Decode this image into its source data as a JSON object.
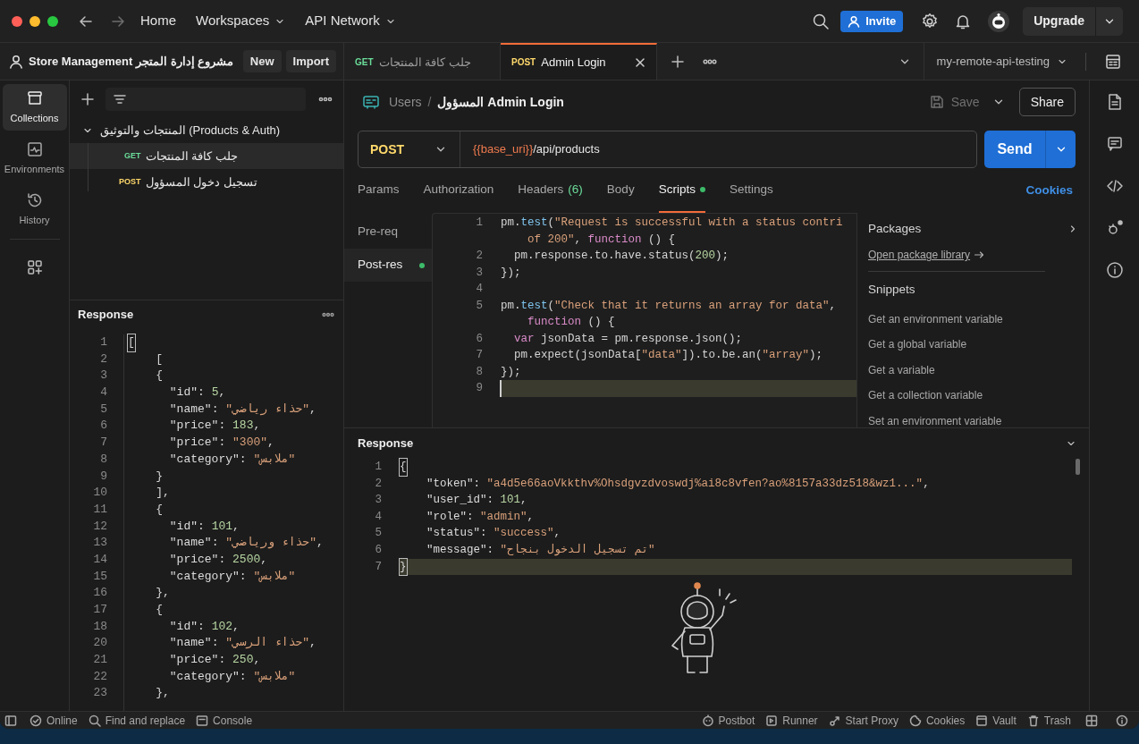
{
  "nav": [
    {
      "label": "Home",
      "dropdown": false
    },
    {
      "label": "Workspaces",
      "dropdown": true
    },
    {
      "label": "API Network",
      "dropdown": true
    }
  ],
  "header": {
    "invite": "Invite",
    "upgrade": "Upgrade"
  },
  "workspace": {
    "name": "Store Management مشروع إدارة المتجر",
    "buttons": [
      "New",
      "Import"
    ]
  },
  "rail": [
    {
      "label": "Collections",
      "selected": true
    },
    {
      "label": "Environments",
      "selected": false
    },
    {
      "label": "History",
      "selected": false
    }
  ],
  "tree": [
    {
      "label": "المنتجات والتوثيق (Products & Auth)",
      "expanded": true,
      "children": [
        {
          "method": "GET",
          "label": "جلب كافة المنتجات",
          "selected": true
        },
        {
          "method": "POST",
          "label": "تسجيل دخول المسؤول",
          "selected": false
        }
      ]
    }
  ],
  "sidebar_response": {
    "title": "Response",
    "lines": [
      {
        "number": "1",
        "segments": [
          {
            "kind": "punct",
            "text": "["
          }
        ]
      },
      {
        "number": "2",
        "segments": [
          {
            "kind": "punct",
            "text": "    ["
          }
        ]
      },
      {
        "number": "3",
        "segments": [
          {
            "kind": "punct",
            "text": "    {"
          }
        ]
      },
      {
        "number": "4",
        "segments": [
          {
            "kind": "key",
            "text": "      \"id\""
          },
          {
            "kind": "punct",
            "text": ": "
          },
          {
            "kind": "number",
            "text": "5"
          },
          {
            "kind": "punct",
            "text": ","
          }
        ]
      },
      {
        "number": "5",
        "segments": [
          {
            "kind": "key",
            "text": "      \"name\""
          },
          {
            "kind": "punct",
            "text": ": "
          },
          {
            "kind": "string",
            "text": "\"حذاء رياضي\""
          },
          {
            "kind": "punct",
            "text": ","
          }
        ]
      },
      {
        "number": "6",
        "segments": [
          {
            "kind": "key",
            "text": "      \"price\""
          },
          {
            "kind": "punct",
            "text": ": "
          },
          {
            "kind": "number",
            "text": "183"
          },
          {
            "kind": "punct",
            "text": ","
          }
        ]
      },
      {
        "number": "7",
        "segments": [
          {
            "kind": "key",
            "text": "      \"price\""
          },
          {
            "kind": "punct",
            "text": ": "
          },
          {
            "kind": "string",
            "text": "\"300\""
          },
          {
            "kind": "punct",
            "text": ","
          }
        ]
      },
      {
        "number": "8",
        "segments": [
          {
            "kind": "key",
            "text": "      \"category\""
          },
          {
            "kind": "punct",
            "text": ": "
          },
          {
            "kind": "string",
            "text": "\"ملابس\""
          }
        ]
      },
      {
        "number": "9",
        "segments": [
          {
            "kind": "punct",
            "text": "    }"
          }
        ]
      },
      {
        "number": "10",
        "segments": [
          {
            "kind": "punct",
            "text": "    ],"
          }
        ]
      },
      {
        "number": "11",
        "segments": [
          {
            "kind": "punct",
            "text": "    {"
          }
        ]
      },
      {
        "number": "12",
        "segments": [
          {
            "kind": "key",
            "text": "      \"id\""
          },
          {
            "kind": "punct",
            "text": ": "
          },
          {
            "kind": "number",
            "text": "101"
          },
          {
            "kind": "punct",
            "text": ","
          }
        ]
      },
      {
        "number": "13",
        "segments": [
          {
            "kind": "key",
            "text": "      \"name\""
          },
          {
            "kind": "punct",
            "text": ": "
          },
          {
            "kind": "string",
            "text": "\"حذاء ورياضي\""
          },
          {
            "kind": "punct",
            "text": ","
          }
        ]
      },
      {
        "number": "14",
        "segments": [
          {
            "kind": "key",
            "text": "      \"price\""
          },
          {
            "kind": "punct",
            "text": ": "
          },
          {
            "kind": "number",
            "text": "2500"
          },
          {
            "kind": "punct",
            "text": ","
          }
        ]
      },
      {
        "number": "15",
        "segments": [
          {
            "kind": "key",
            "text": "      \"category\""
          },
          {
            "kind": "punct",
            "text": ": "
          },
          {
            "kind": "string",
            "text": "\"ملابس\""
          }
        ]
      },
      {
        "number": "16",
        "segments": [
          {
            "kind": "punct",
            "text": "    },"
          }
        ]
      },
      {
        "number": "17",
        "segments": [
          {
            "kind": "punct",
            "text": "    {"
          }
        ]
      },
      {
        "number": "18",
        "segments": [
          {
            "kind": "key",
            "text": "      \"id\""
          },
          {
            "kind": "punct",
            "text": ": "
          },
          {
            "kind": "number",
            "text": "102"
          },
          {
            "kind": "punct",
            "text": ","
          }
        ]
      },
      {
        "number": "20",
        "segments": [
          {
            "kind": "key",
            "text": "      \"name\""
          },
          {
            "kind": "punct",
            "text": ": "
          },
          {
            "kind": "string",
            "text": "\"حذاء الرسي\""
          },
          {
            "kind": "punct",
            "text": ","
          }
        ]
      },
      {
        "number": "21",
        "segments": [
          {
            "kind": "key",
            "text": "      \"price\""
          },
          {
            "kind": "punct",
            "text": ": "
          },
          {
            "kind": "number",
            "text": "250"
          },
          {
            "kind": "punct",
            "text": ","
          }
        ]
      },
      {
        "number": "22",
        "segments": [
          {
            "kind": "key",
            "text": "      \"category\""
          },
          {
            "kind": "punct",
            "text": ": "
          },
          {
            "kind": "string",
            "text": "\"ملابس\""
          }
        ]
      },
      {
        "number": "23",
        "segments": [
          {
            "kind": "punct",
            "text": "    },"
          }
        ]
      }
    ]
  },
  "tabs": [
    {
      "method": "GET",
      "label": "جلب كافة المنتجات",
      "selected": false
    },
    {
      "method": "POST",
      "label": "Admin Login",
      "selected": true
    }
  ],
  "environment": "my-remote-api-testing",
  "breadcrumb": {
    "parent": "Users",
    "separator": "/",
    "current": "المسؤول Admin Login"
  },
  "save": "Save",
  "share": "Share",
  "request": {
    "method": "POST",
    "url_variable": "{{base_uri}}",
    "url_path": "/api/products",
    "send": "Send"
  },
  "request_tabs": [
    {
      "label": "Params",
      "selected": false,
      "indicator": false
    },
    {
      "label": "Authorization",
      "selected": false,
      "indicator": false
    },
    {
      "label": "Headers",
      "count": "(6)",
      "selected": false,
      "indicator": false
    },
    {
      "label": "Body",
      "selected": false,
      "indicator": false
    },
    {
      "label": "Scripts",
      "selected": true,
      "indicator": true
    },
    {
      "label": "Settings",
      "selected": false,
      "indicator": false
    }
  ],
  "cookies_link": "Cookies",
  "script_phases": [
    {
      "label": "Pre-req",
      "selected": false,
      "indicator": false
    },
    {
      "label": "Post-res",
      "selected": true,
      "indicator": true
    }
  ],
  "script_lines": [
    {
      "number": "1",
      "current": false,
      "segments": [
        {
          "kind": "punct",
          "text": "pm."
        },
        {
          "kind": "function",
          "text": "test"
        },
        {
          "kind": "punct",
          "text": "("
        },
        {
          "kind": "string",
          "text": "\"Request is successful with a status contri"
        }
      ]
    },
    {
      "current": false,
      "segments": [
        {
          "kind": "string",
          "text": "    of 200\""
        },
        {
          "kind": "punct",
          "text": ", "
        },
        {
          "kind": "keyword",
          "text": "function"
        },
        {
          "kind": "punct",
          "text": " () {"
        }
      ]
    },
    {
      "number": "2",
      "current": false,
      "segments": [
        {
          "kind": "punct",
          "text": "  pm.response.to.have.status("
        },
        {
          "kind": "number",
          "text": "200"
        },
        {
          "kind": "punct",
          "text": ");"
        }
      ]
    },
    {
      "number": "3",
      "current": false,
      "segments": [
        {
          "kind": "punct",
          "text": "});"
        }
      ]
    },
    {
      "number": "4",
      "current": false
    },
    {
      "number": "5",
      "current": false,
      "segments": [
        {
          "kind": "punct",
          "text": "pm."
        },
        {
          "kind": "function",
          "text": "test"
        },
        {
          "kind": "punct",
          "text": "("
        },
        {
          "kind": "string",
          "text": "\"Check that it returns an array for data\""
        },
        {
          "kind": "punct",
          "text": ","
        }
      ]
    },
    {
      "current": false,
      "segments": [
        {
          "kind": "keyword",
          "text": "    function"
        },
        {
          "kind": "punct",
          "text": " () {"
        }
      ]
    },
    {
      "number": "6",
      "current": false,
      "segments": [
        {
          "kind": "keyword",
          "text": "  var"
        },
        {
          "kind": "punct",
          "text": " jsonData = pm.response.json();"
        }
      ]
    },
    {
      "number": "7",
      "current": false,
      "segments": [
        {
          "kind": "punct",
          "text": "  pm.expect(jsonData["
        },
        {
          "kind": "string",
          "text": "\"data\""
        },
        {
          "kind": "punct",
          "text": "]).to.be.an("
        },
        {
          "kind": "string",
          "text": "\"array\""
        },
        {
          "kind": "punct",
          "text": ");"
        }
      ]
    },
    {
      "number": "8",
      "current": false,
      "segments": [
        {
          "kind": "punct",
          "text": "});"
        }
      ]
    },
    {
      "number": "9",
      "current": true
    }
  ],
  "packages": {
    "title": "Packages",
    "link": "Open package library"
  },
  "snippets": {
    "title": "Snippets",
    "items": [
      "Get an environment variable",
      "Get a global variable",
      "Get a variable",
      "Get a collection variable",
      "Set an environment variable"
    ]
  },
  "response": {
    "title": "Response",
    "lines": [
      {
        "number": "1",
        "current": false,
        "segments": [
          {
            "kind": "punct",
            "text": "{"
          }
        ]
      },
      {
        "number": "2",
        "current": false,
        "segments": [
          {
            "kind": "key",
            "text": "    \"token\""
          },
          {
            "kind": "punct",
            "text": ": "
          },
          {
            "kind": "string",
            "text": "\"a4d5e66aoVkkthv%Ohsdgvzdvoswdj%ai8c8vfen?ao%8157a33dz518&wz1...\""
          },
          {
            "kind": "punct",
            "text": ","
          }
        ]
      },
      {
        "number": "3",
        "current": false,
        "segments": [
          {
            "kind": "key",
            "text": "    \"user_id\""
          },
          {
            "kind": "punct",
            "text": ": "
          },
          {
            "kind": "number",
            "text": "101"
          },
          {
            "kind": "punct",
            "text": ","
          }
        ]
      },
      {
        "number": "4",
        "current": false,
        "segments": [
          {
            "kind": "key",
            "text": "    \"role\""
          },
          {
            "kind": "punct",
            "text": ": "
          },
          {
            "kind": "string",
            "text": "\"admin\""
          },
          {
            "kind": "punct",
            "text": ","
          }
        ]
      },
      {
        "number": "5",
        "current": false,
        "segments": [
          {
            "kind": "key",
            "text": "    \"status\""
          },
          {
            "kind": "punct",
            "text": ": "
          },
          {
            "kind": "string",
            "text": "\"success\""
          },
          {
            "kind": "punct",
            "text": ","
          }
        ]
      },
      {
        "number": "6",
        "current": false,
        "segments": [
          {
            "kind": "key",
            "text": "    \"message\""
          },
          {
            "kind": "punct",
            "text": ": "
          },
          {
            "kind": "string",
            "text": "\"تم تسجيل الدخول بنجاح\""
          }
        ]
      },
      {
        "number": "7",
        "current": true,
        "segments": [
          {
            "kind": "punct",
            "text": "}"
          }
        ]
      }
    ]
  },
  "status_bar": {
    "left": [
      {
        "kind": "online",
        "label": "Online"
      },
      {
        "kind": "search",
        "label": "Find and replace"
      },
      {
        "kind": "console",
        "label": "Console"
      }
    ],
    "right": [
      {
        "kind": "postbot",
        "label": "Postbot"
      },
      {
        "kind": "runner",
        "label": "Runner"
      },
      {
        "kind": "proxy",
        "label": "Start Proxy"
      },
      {
        "kind": "cookies",
        "label": "Cookies"
      },
      {
        "kind": "vault",
        "label": "Vault"
      },
      {
        "kind": "trash",
        "label": "Trash"
      }
    ]
  }
}
